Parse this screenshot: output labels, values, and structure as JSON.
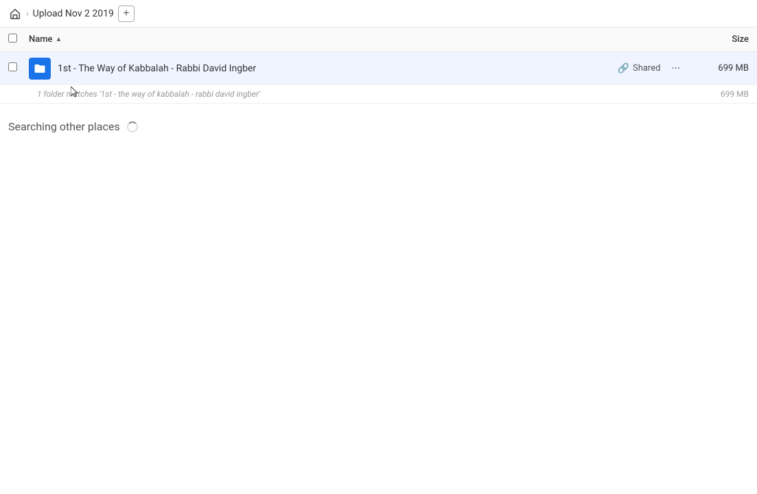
{
  "breadcrumb": {
    "home_icon": "home",
    "title": "Upload Nov 2 2019",
    "add_button_label": "+"
  },
  "columns": {
    "checkbox_label": "",
    "name_label": "Name",
    "sort_indicator": "▲",
    "size_label": "Size"
  },
  "result": {
    "folder_icon": "folder-link",
    "name": "1st - The Way of Kabbalah - Rabbi David Ingber",
    "shared_label": "Shared",
    "more_label": "···",
    "size": "699 MB"
  },
  "match": {
    "text": "1 folder matches '1st - the way of kabbalah - rabbi david ingber'",
    "size": "699 MB"
  },
  "searching": {
    "text": "Searching other places"
  }
}
